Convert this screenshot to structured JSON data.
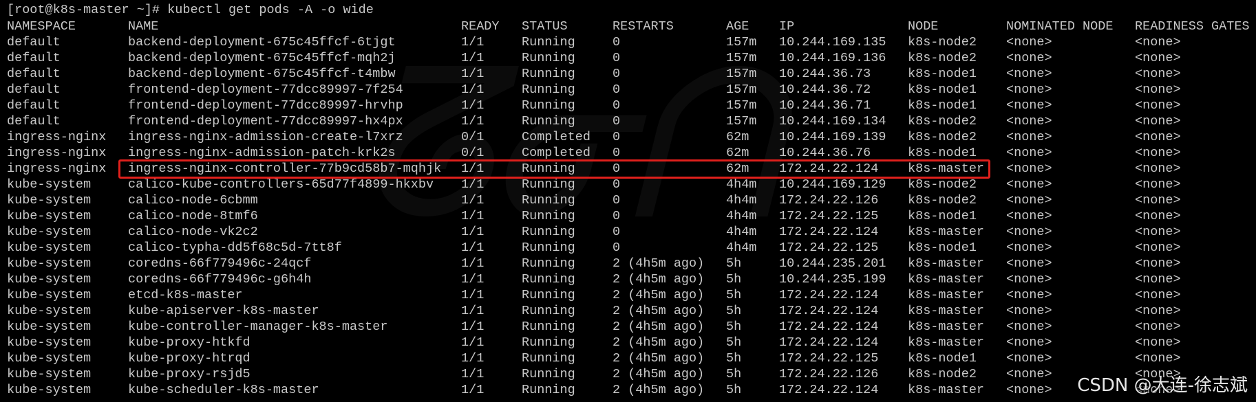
{
  "prompt": "[root@k8s-master ~]# kubectl get pods -A -o wide",
  "headers": [
    "NAMESPACE",
    "NAME",
    "READY",
    "STATUS",
    "RESTARTS",
    "AGE",
    "IP",
    "NODE",
    "NOMINATED NODE",
    "READINESS GATES"
  ],
  "rows": [
    [
      "default",
      "backend-deployment-675c45ffcf-6tjgt",
      "1/1",
      "Running",
      "0",
      "157m",
      "10.244.169.135",
      "k8s-node2",
      "<none>",
      "<none>"
    ],
    [
      "default",
      "backend-deployment-675c45ffcf-mqh2j",
      "1/1",
      "Running",
      "0",
      "157m",
      "10.244.169.136",
      "k8s-node2",
      "<none>",
      "<none>"
    ],
    [
      "default",
      "backend-deployment-675c45ffcf-t4mbw",
      "1/1",
      "Running",
      "0",
      "157m",
      "10.244.36.73",
      "k8s-node1",
      "<none>",
      "<none>"
    ],
    [
      "default",
      "frontend-deployment-77dcc89997-7f254",
      "1/1",
      "Running",
      "0",
      "157m",
      "10.244.36.72",
      "k8s-node1",
      "<none>",
      "<none>"
    ],
    [
      "default",
      "frontend-deployment-77dcc89997-hrvhp",
      "1/1",
      "Running",
      "0",
      "157m",
      "10.244.36.71",
      "k8s-node1",
      "<none>",
      "<none>"
    ],
    [
      "default",
      "frontend-deployment-77dcc89997-hx4px",
      "1/1",
      "Running",
      "0",
      "157m",
      "10.244.169.134",
      "k8s-node2",
      "<none>",
      "<none>"
    ],
    [
      "ingress-nginx",
      "ingress-nginx-admission-create-l7xrz",
      "0/1",
      "Completed",
      "0",
      "62m",
      "10.244.169.139",
      "k8s-node2",
      "<none>",
      "<none>"
    ],
    [
      "ingress-nginx",
      "ingress-nginx-admission-patch-krk2s",
      "0/1",
      "Completed",
      "0",
      "62m",
      "10.244.36.76",
      "k8s-node1",
      "<none>",
      "<none>"
    ],
    [
      "ingress-nginx",
      "ingress-nginx-controller-77b9cd58b7-mqhjk",
      "1/1",
      "Running",
      "0",
      "62m",
      "172.24.22.124",
      "k8s-master",
      "<none>",
      "<none>"
    ],
    [
      "kube-system",
      "calico-kube-controllers-65d77f4899-hkxbv",
      "1/1",
      "Running",
      "0",
      "4h4m",
      "10.244.169.129",
      "k8s-node2",
      "<none>",
      "<none>"
    ],
    [
      "kube-system",
      "calico-node-6cbmm",
      "1/1",
      "Running",
      "0",
      "4h4m",
      "172.24.22.126",
      "k8s-node2",
      "<none>",
      "<none>"
    ],
    [
      "kube-system",
      "calico-node-8tmf6",
      "1/1",
      "Running",
      "0",
      "4h4m",
      "172.24.22.125",
      "k8s-node1",
      "<none>",
      "<none>"
    ],
    [
      "kube-system",
      "calico-node-vk2c2",
      "1/1",
      "Running",
      "0",
      "4h4m",
      "172.24.22.124",
      "k8s-master",
      "<none>",
      "<none>"
    ],
    [
      "kube-system",
      "calico-typha-dd5f68c5d-7tt8f",
      "1/1",
      "Running",
      "0",
      "4h4m",
      "172.24.22.125",
      "k8s-node1",
      "<none>",
      "<none>"
    ],
    [
      "kube-system",
      "coredns-66f779496c-24qcf",
      "1/1",
      "Running",
      "2 (4h5m ago)",
      "5h",
      "10.244.235.201",
      "k8s-master",
      "<none>",
      "<none>"
    ],
    [
      "kube-system",
      "coredns-66f779496c-g6h4h",
      "1/1",
      "Running",
      "2 (4h5m ago)",
      "5h",
      "10.244.235.199",
      "k8s-master",
      "<none>",
      "<none>"
    ],
    [
      "kube-system",
      "etcd-k8s-master",
      "1/1",
      "Running",
      "2 (4h5m ago)",
      "5h",
      "172.24.22.124",
      "k8s-master",
      "<none>",
      "<none>"
    ],
    [
      "kube-system",
      "kube-apiserver-k8s-master",
      "1/1",
      "Running",
      "2 (4h5m ago)",
      "5h",
      "172.24.22.124",
      "k8s-master",
      "<none>",
      "<none>"
    ],
    [
      "kube-system",
      "kube-controller-manager-k8s-master",
      "1/1",
      "Running",
      "2 (4h5m ago)",
      "5h",
      "172.24.22.124",
      "k8s-master",
      "<none>",
      "<none>"
    ],
    [
      "kube-system",
      "kube-proxy-htkfd",
      "1/1",
      "Running",
      "2 (4h5m ago)",
      "5h",
      "172.24.22.124",
      "k8s-master",
      "<none>",
      "<none>"
    ],
    [
      "kube-system",
      "kube-proxy-htrqd",
      "1/1",
      "Running",
      "2 (4h5m ago)",
      "5h",
      "172.24.22.125",
      "k8s-node1",
      "<none>",
      "<none>"
    ],
    [
      "kube-system",
      "kube-proxy-rsjd5",
      "1/1",
      "Running",
      "2 (4h5m ago)",
      "5h",
      "172.24.22.126",
      "k8s-node2",
      "<none>",
      "<none>"
    ],
    [
      "kube-system",
      "kube-scheduler-k8s-master",
      "1/1",
      "Running",
      "2 (4h5m ago)",
      "5h",
      "172.24.22.124",
      "k8s-master",
      "<none>",
      "<none>"
    ]
  ],
  "highlighted_row": 8,
  "watermark_credit": "CSDN @大连-徐志斌",
  "colors": {
    "background": "#000000",
    "text": "#c8c8c8",
    "highlight": "#e0201c"
  }
}
